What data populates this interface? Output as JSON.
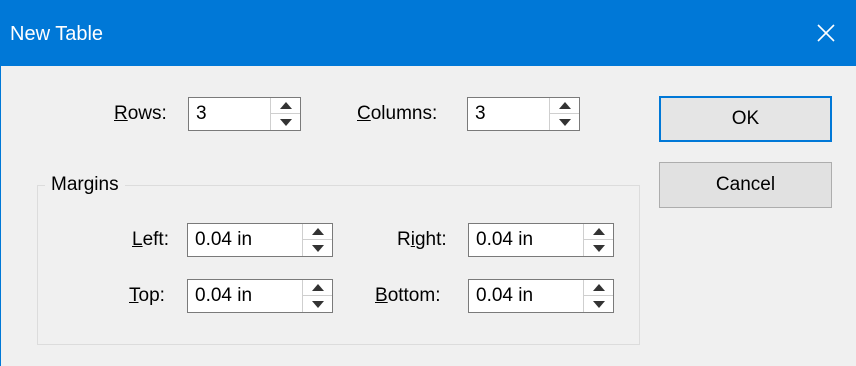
{
  "window": {
    "title": "New Table",
    "accent_color": "#0078d7",
    "close_icon": "close-icon"
  },
  "table": {
    "rows": {
      "label_key": "R",
      "label_rest": "ows:",
      "value": "3"
    },
    "columns": {
      "label_key": "C",
      "label_rest": "olumns:",
      "value": "3"
    }
  },
  "margins": {
    "group_title": "Margins",
    "left": {
      "label_key": "L",
      "label_rest": "eft:",
      "value": "0.04 in"
    },
    "right": {
      "label_pre": "R",
      "label_key": "i",
      "label_rest": "ght:",
      "value": "0.04 in"
    },
    "top": {
      "label_key": "T",
      "label_rest": "op:",
      "value": "0.04 in"
    },
    "bottom": {
      "label_key": "B",
      "label_rest": "ottom:",
      "value": "0.04 in"
    }
  },
  "buttons": {
    "ok": "OK",
    "cancel": "Cancel"
  }
}
